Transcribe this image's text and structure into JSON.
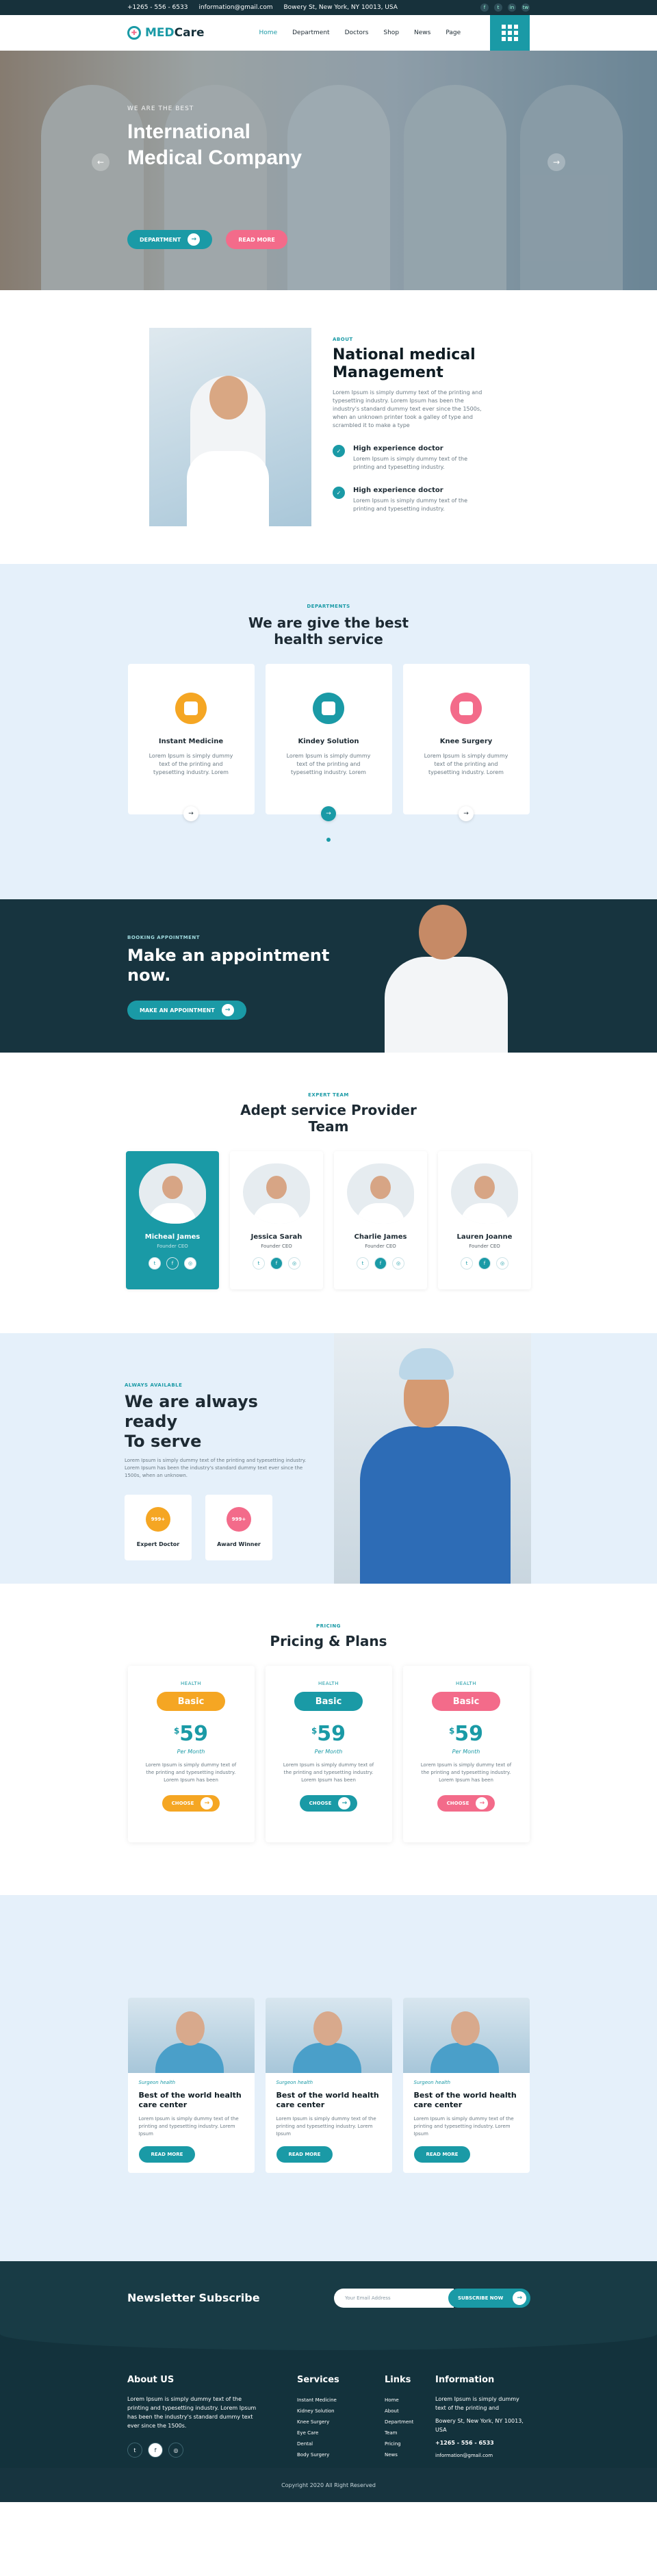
{
  "topbar": {
    "phone": "+1265 - 556 - 6533",
    "email": "information@gmail.com",
    "address": "Bowery St, New York, NY 10013, USA",
    "social": [
      "f",
      "t",
      "in",
      "tw"
    ]
  },
  "nav": {
    "logo_med": "MED",
    "logo_care": "Care",
    "menu": [
      "Home",
      "Department",
      "Doctors",
      "Shop",
      "News",
      "Page"
    ]
  },
  "hero": {
    "subtitle": "WE ARE THE BEST",
    "title_1": "International",
    "title_2": "Medical Company",
    "btn_department": "DEPARTMENT",
    "btn_read": "READ MORE"
  },
  "about": {
    "tag": "ABOUT",
    "title": "National medical Management",
    "text": "Lorem Ipsum is simply dummy text of the printing and typesetting industry. Lorem Ipsum has been the industry's standard dummy text ever since the 1500s, when an unknown printer took a galley of type and scrambled it to make a type",
    "features": [
      {
        "title": "High experience doctor",
        "text": "Lorem Ipsum is simply dummy text of the printing and typesetting industry."
      },
      {
        "title": "High experience doctor",
        "text": "Lorem Ipsum is simply dummy text of the printing and typesetting industry."
      }
    ]
  },
  "services": {
    "tag": "DEPARTMENTS",
    "title_1": "We are give the best",
    "title_2": "health service",
    "cards": [
      {
        "title": "Instant Medicine",
        "text": "Lorem Ipsum is simply dummy text of the printing and typesetting industry. Lorem",
        "color": "#f5a623"
      },
      {
        "title": "Kindey Solution",
        "text": "Lorem Ipsum is simply dummy text of the printing and typesetting industry. Lorem",
        "color": "#1a9aa6"
      },
      {
        "title": "Knee Surgery",
        "text": "Lorem Ipsum is simply dummy text of the printing and typesetting industry. Lorem",
        "color": "#f36b8a"
      }
    ]
  },
  "appointment": {
    "tag": "BOOKING APPOINTMENT",
    "title_1": "Make an appointment",
    "title_2": "now.",
    "btn": "MAKE AN APPOINTMENT"
  },
  "team": {
    "tag": "EXPERT TEAM",
    "title_1": "Adept service Provider",
    "title_2": "Team",
    "members": [
      {
        "name": "Micheal James",
        "role": "Founder CEO"
      },
      {
        "name": "Jessica Sarah",
        "role": "Founder CEO"
      },
      {
        "name": "Charlie James",
        "role": "Founder CEO"
      },
      {
        "name": "Lauren Joanne",
        "role": "Founder CEO"
      }
    ]
  },
  "ready": {
    "tag": "ALWAYS AVAILABLE",
    "title_1": "We are always ready",
    "title_2": "To serve",
    "text": "Lorem Ipsum is simply dummy text of the printing and typesetting industry. Lorem Ipsum has been the industry's standard dummy text ever since the 1500s, when an unknown.",
    "badges": [
      {
        "value": "999+",
        "label": "Expert Doctor",
        "color": "#f5a623"
      },
      {
        "value": "999+",
        "label": "Award Winner",
        "color": "#f36b8a"
      }
    ]
  },
  "pricing": {
    "tag": "PRICING",
    "title": "Pricing & Plans",
    "plans": [
      {
        "label": "HEALTH",
        "name": "Basic",
        "currency": "$",
        "price": "59",
        "per": "Per Month",
        "text": "Lorem Ipsum is simply dummy text of the printing and typesetting industry. Lorem Ipsum has been",
        "btn": "CHOOSE",
        "color": "#f5a623"
      },
      {
        "label": "HEALTH",
        "name": "Basic",
        "currency": "$",
        "price": "59",
        "per": "Per Month",
        "text": "Lorem Ipsum is simply dummy text of the printing and typesetting industry. Lorem Ipsum has been",
        "btn": "CHOOSE",
        "color": "#1a9aa6"
      },
      {
        "label": "HEALTH",
        "name": "Basic",
        "currency": "$",
        "price": "59",
        "per": "Per Month",
        "text": "Lorem Ipsum is simply dummy text of the printing and typesetting industry. Lorem Ipsum has been",
        "btn": "CHOOSE",
        "color": "#f36b8a"
      }
    ]
  },
  "blog": {
    "posts": [
      {
        "meta": "Surgeon   health",
        "title": "Best of the world health care center",
        "text": "Lorem Ipsum is simply dummy text of the printing and typesetting industry. Lorem Ipsum",
        "btn": "READ MORE"
      },
      {
        "meta": "Surgeon   health",
        "title": "Best of the world health care center",
        "text": "Lorem Ipsum is simply dummy text of the printing and typesetting industry. Lorem Ipsum",
        "btn": "READ MORE"
      },
      {
        "meta": "Surgeon   health",
        "title": "Best of the world health care center",
        "text": "Lorem Ipsum is simply dummy text of the printing and typesetting industry. Lorem Ipsum",
        "btn": "READ MORE"
      }
    ]
  },
  "newsletter": {
    "title": "Newsletter Subscribe",
    "placeholder": "Your Email Address",
    "btn": "SUBSCRIBE NOW"
  },
  "footer": {
    "about_title": "About US",
    "about_text": "Lorem Ipsum is simply dummy text of the printing and typesetting industry. Lorem Ipsum has been the industry's standard dummy text ever since the 1500s.",
    "services_title": "Services",
    "services": [
      "Instant Medicine",
      "Kidney Solution",
      "Knee Surgery",
      "Eye Care",
      "Dental",
      "Body Surgery"
    ],
    "links_title": "Links",
    "links": [
      "Home",
      "About",
      "Department",
      "Team",
      "Pricing",
      "News"
    ],
    "info_title": "Information",
    "info_text": "Lorem Ipsum is simply dummy text of the printing and",
    "address": "Bowery St, New York, NY 10013, USA",
    "phone": "+1265 - 556 - 6533",
    "email": "information@gmail.com",
    "copyright": "Copyright 2020 All Right Reserved"
  }
}
